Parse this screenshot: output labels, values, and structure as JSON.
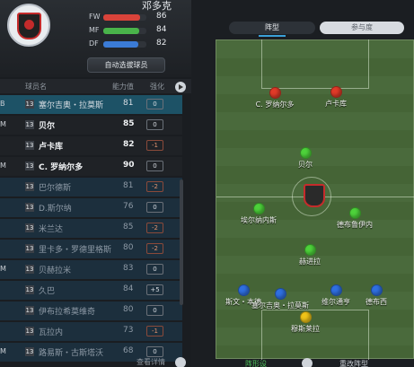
{
  "club": {
    "name": "邓多克",
    "stats": [
      {
        "label": "FW",
        "value": 86,
        "fill": 0.86,
        "color": "#d9433a"
      },
      {
        "label": "MF",
        "value": 84,
        "fill": 0.84,
        "color": "#49b34a"
      },
      {
        "label": "DF",
        "value": 82,
        "fill": 0.82,
        "color": "#3b7bd6"
      }
    ],
    "auto_select_label": "自动选拔球员"
  },
  "table": {
    "headers": {
      "name": "球员名",
      "rating": "能力值",
      "change": "强化"
    },
    "rows": [
      {
        "pos": "B",
        "num": "13",
        "name": "塞尔吉奥・拉莫斯",
        "rating": "81",
        "change": "0",
        "style": "selected"
      },
      {
        "pos": "M",
        "num": "13",
        "name": "贝尔",
        "rating": "85",
        "change": "0",
        "style": "starter"
      },
      {
        "pos": "",
        "num": "13",
        "name": "卢卡库",
        "rating": "82",
        "change": "-1",
        "style": "starter"
      },
      {
        "pos": "M",
        "num": "13",
        "name": "C. 罗纳尔多",
        "rating": "90",
        "change": "0",
        "style": "starter"
      },
      {
        "pos": "",
        "num": "13",
        "name": "巴尔德斯",
        "rating": "81",
        "change": "-2",
        "style": "sub"
      },
      {
        "pos": "",
        "num": "13",
        "name": "D.斯尔纳",
        "rating": "76",
        "change": "0",
        "style": "sub"
      },
      {
        "pos": "",
        "num": "13",
        "name": "米兰达",
        "rating": "85",
        "change": "-2",
        "style": "sub"
      },
      {
        "pos": "",
        "num": "13",
        "name": "里卡多・罗德里格斯",
        "rating": "80",
        "change": "-2",
        "style": "sub"
      },
      {
        "pos": "M",
        "num": "13",
        "name": "贝赫拉米",
        "rating": "83",
        "change": "0",
        "style": "sub"
      },
      {
        "pos": "",
        "num": "13",
        "name": "久巴",
        "rating": "84",
        "change": "+5",
        "style": "sub"
      },
      {
        "pos": "",
        "num": "13",
        "name": "伊布拉希莫维奇",
        "rating": "80",
        "change": "0",
        "style": "sub"
      },
      {
        "pos": "",
        "num": "13",
        "name": "瓦拉内",
        "rating": "73",
        "change": "-1",
        "style": "sub"
      },
      {
        "pos": "M",
        "num": "13",
        "name": "路易斯・古斯塔沃",
        "rating": "68",
        "change": "0",
        "style": "sub"
      }
    ],
    "footer_label": "查看详情"
  },
  "tabs": {
    "formation": "阵型",
    "attributes": "参与度"
  },
  "pitch": {
    "players": [
      {
        "name": "C. 罗纳尔多",
        "color": "#e13a28"
      },
      {
        "name": "卢卡库",
        "color": "#e13a28"
      },
      {
        "name": "贝尔",
        "color": "#4dd23a"
      },
      {
        "name": "埃尔纳内斯",
        "color": "#4dd23a"
      },
      {
        "name": "德布鲁伊内",
        "color": "#4dd23a"
      },
      {
        "name": "赫进拉",
        "color": "#4dd23a"
      },
      {
        "name": "斯文・本德",
        "color": "#2f6fe0"
      },
      {
        "name": "塞尔吉奥・拉莫斯",
        "color": "#2f6fe0"
      },
      {
        "name": "维尔通亨",
        "color": "#2f6fe0"
      },
      {
        "name": "德布西",
        "color": "#2f6fe0"
      },
      {
        "name": "穆斯莱拉",
        "color": "#f0c318"
      }
    ]
  },
  "actions": {
    "change": "阵形设",
    "reformation": "重改阵型"
  }
}
